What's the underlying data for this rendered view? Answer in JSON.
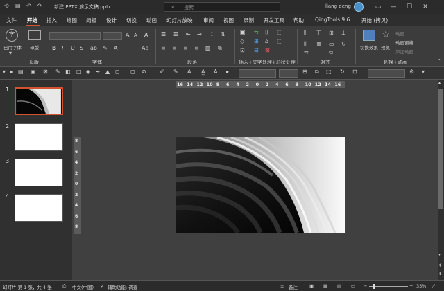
{
  "window": {
    "title": "新建 PPTX 演示文稿.pptx",
    "search_placeholder": "搜索",
    "user": "liang deng",
    "controls": [
      "minimize-icon",
      "maximize-icon",
      "close-icon"
    ]
  },
  "ribbon_tabs": {
    "items": [
      "文件",
      "开始",
      "插入",
      "绘图",
      "简报",
      "设计",
      "切换",
      "动画",
      "幻灯片放映",
      "审阅",
      "视图",
      "录制",
      "开发工具",
      "帮助",
      "QingTools 9.6",
      "开始 (拷贝)"
    ],
    "active": "开始"
  },
  "ribbon": {
    "used_font": "已用字体",
    "layout": "母版",
    "group_master": "母版",
    "group_font": "字体",
    "group_paragraph": "段落",
    "group_insert": "插入+文字处理+形状处理",
    "group_align": "对齐",
    "group_transition": "切换+动画",
    "transition_effect": "切换效果",
    "preview": "预览",
    "anim_pane": "动画窗格",
    "add_anim": "添加动画",
    "anim_label": "动画",
    "font_sizes": [
      "A",
      "A"
    ],
    "format_buttons": [
      "B",
      "I",
      "U",
      "S",
      "ab",
      "A"
    ]
  },
  "thumbnails": {
    "numbers": [
      "1",
      "2",
      "3",
      "4"
    ]
  },
  "ruler": {
    "h": [
      "16",
      "14",
      "12",
      "10",
      "8",
      "6",
      "4",
      "2",
      "0",
      "2",
      "4",
      "6",
      "8",
      "10",
      "12",
      "14",
      "16"
    ],
    "v": [
      "8",
      "6",
      "4",
      "2",
      "0",
      "2",
      "4",
      "6",
      "8"
    ]
  },
  "status": {
    "slide": "幻灯片 第 1 张，共 4 张",
    "lang": "中文(中国)",
    "access": "辅助功能: 调查",
    "notes": "备注",
    "zoom": "33%"
  }
}
